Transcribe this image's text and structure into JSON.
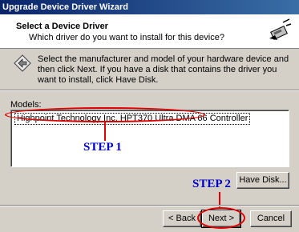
{
  "window": {
    "title": "Upgrade Device Driver Wizard"
  },
  "header": {
    "title": "Select a Device Driver",
    "subtitle": "Which driver do you want to install for this device?"
  },
  "instructions": "Select the manufacturer and model of your hardware device and then click Next. If you have a disk that contains the driver you want to install, click Have Disk.",
  "models": {
    "label": "Models:",
    "items": [
      "Highpoint Technology Inc. HPT370 Ultra DMA 66 Controller"
    ],
    "selected_index": 0
  },
  "annotations": {
    "step1": "STEP 1",
    "step2": "STEP 2",
    "color": "#e00000",
    "text_color": "#0000c8"
  },
  "buttons": {
    "have_disk": "Have Disk...",
    "back": "< Back",
    "next": "Next >",
    "cancel": "Cancel"
  },
  "icons": {
    "wizard": "hardware-wizard-icon",
    "info": "diamond-arrow-icon"
  }
}
